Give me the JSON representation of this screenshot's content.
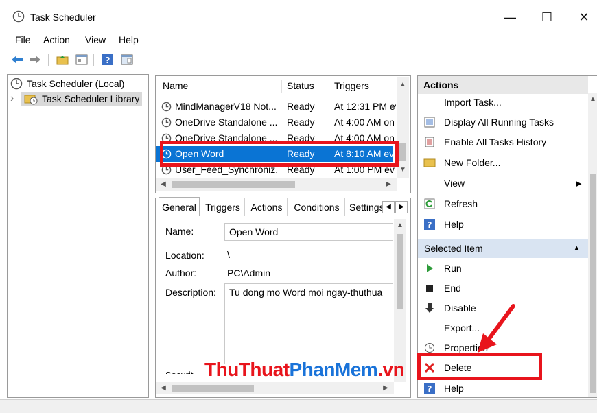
{
  "window": {
    "title": "Task Scheduler",
    "minimize": "—",
    "maximize": "☐",
    "close": "✕"
  },
  "menu": [
    "File",
    "Action",
    "View",
    "Help"
  ],
  "tree": {
    "root": "Task Scheduler (Local)",
    "child": "Task Scheduler Library",
    "expand_glyph": "›"
  },
  "task_list": {
    "columns": [
      "Name",
      "Status",
      "Triggers"
    ],
    "rows": [
      {
        "name": "MindManagerV18 Not...",
        "status": "Ready",
        "trigger": "At 12:31 PM ev"
      },
      {
        "name": "OneDrive Standalone ...",
        "status": "Ready",
        "trigger": "At 4:00 AM on"
      },
      {
        "name": "OneDrive Standalone ...",
        "status": "Ready",
        "trigger": "At 4:00 AM on"
      },
      {
        "name": "Open Word",
        "status": "Ready",
        "trigger": "At 8:10 AM ev"
      },
      {
        "name": "User_Feed_Synchroniz...",
        "status": "Ready",
        "trigger": "At 1:00 PM ev"
      }
    ],
    "selected_index": 3
  },
  "tabs": [
    "General",
    "Triggers",
    "Actions",
    "Conditions",
    "Settings"
  ],
  "properties": {
    "name_label": "Name:",
    "name_value": "Open Word",
    "location_label": "Location:",
    "location_value": "\\",
    "author_label": "Author:",
    "author_value": "PC\\Admin",
    "description_label": "Description:",
    "description_value": "Tu dong mo Word moi ngay-thuthua",
    "security_label": "Securit..."
  },
  "actions": {
    "header": "Actions",
    "items": [
      "Import Task...",
      "Display All Running Tasks",
      "Enable All Tasks History",
      "New Folder...",
      "View",
      "Refresh",
      "Help"
    ],
    "selected_header": "Selected Item",
    "selected_items": [
      "Run",
      "End",
      "Disable",
      "Export...",
      "Properties",
      "Delete",
      "Help"
    ]
  },
  "watermark": {
    "part1": "ThuThuat",
    "part2": "PhanMem",
    "part3": ".vn"
  },
  "colors": {
    "selection": "#0a74d4",
    "highlight": "#e8141c",
    "section_header": "#d9e4f2",
    "wm1": "#e8141c",
    "wm2": "#1a73d9"
  }
}
